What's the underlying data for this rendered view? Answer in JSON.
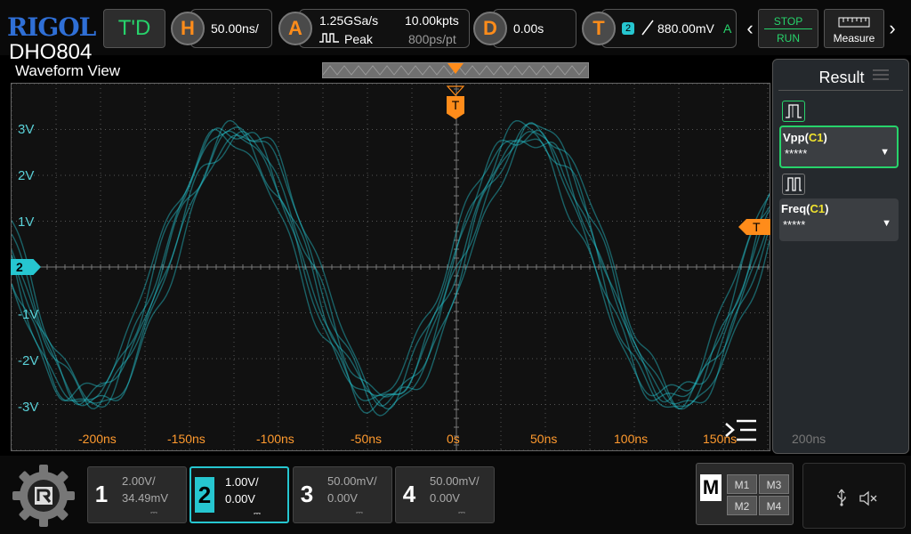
{
  "brand": "RIGOL",
  "model": "DHO804",
  "topbar": {
    "td_label": "T'D",
    "horizontal": {
      "key": "H",
      "timebase": "50.00ns/"
    },
    "acquire": {
      "key": "A",
      "sample_rate": "1.25GSa/s",
      "mode": "Peak",
      "mem_depth": "10.00kpts",
      "resolution": "800ps/pt"
    },
    "delay": {
      "key": "D",
      "value": "0.00s"
    },
    "trigger": {
      "key": "T",
      "source": "2",
      "level": "880.00mV",
      "sweep": "A"
    },
    "stop_label": "STOP",
    "run_label": "RUN",
    "measure_label": "Measure"
  },
  "waveform": {
    "title": "Waveform View",
    "channel_marker": "2",
    "trigger_marker": "T",
    "trigger_pos_marker": "T",
    "y_labels": [
      "3V",
      "2V",
      "1V",
      "-1V",
      "-2V",
      "-3V"
    ],
    "x_labels": [
      "-200ns",
      "-150ns",
      "-100ns",
      "-50ns",
      "0s",
      "50ns",
      "100ns",
      "150ns",
      "200ns"
    ]
  },
  "result": {
    "title": "Result",
    "items": [
      {
        "name": "Vpp",
        "source": "C1",
        "value": "*****"
      },
      {
        "name": "Freq",
        "source": "C1",
        "value": "*****"
      }
    ]
  },
  "channels": [
    {
      "num": "1",
      "scale": "2.00V/",
      "offset": "34.49mV",
      "active": false
    },
    {
      "num": "2",
      "scale": "1.00V/",
      "offset": "0.00V",
      "active": true
    },
    {
      "num": "3",
      "scale": "50.00mV/",
      "offset": "0.00V",
      "active": false
    },
    {
      "num": "4",
      "scale": "50.00mV/",
      "offset": "0.00V",
      "active": false
    }
  ],
  "math": {
    "key": "M",
    "m1": "M1",
    "m2": "M2",
    "m3": "M3",
    "m4": "M4"
  },
  "colors": {
    "ch2": "#26c6d0",
    "trigger": "#ff8c1a",
    "td": "#27d36b",
    "brand": "#2f6fd6"
  }
}
